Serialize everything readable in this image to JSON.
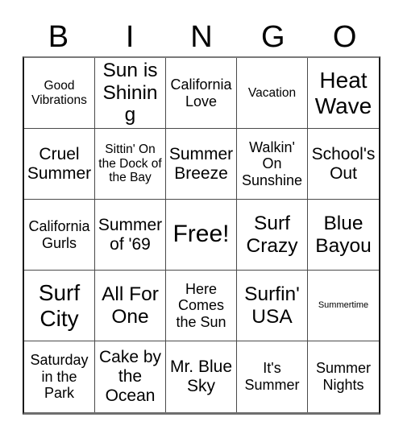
{
  "header": {
    "letters": [
      "B",
      "I",
      "N",
      "G",
      "O"
    ]
  },
  "grid": {
    "rows": [
      [
        {
          "text": "Good Vibrations",
          "size": "fs-sm"
        },
        {
          "text": "Sun is Shining",
          "size": "fs-xl"
        },
        {
          "text": "California Love",
          "size": "fs-md"
        },
        {
          "text": "Vacation",
          "size": "fs-sm"
        },
        {
          "text": "Heat Wave",
          "size": "fs-xxl"
        }
      ],
      [
        {
          "text": "Cruel Summer",
          "size": "fs-lg"
        },
        {
          "text": "Sittin' On the Dock of the Bay",
          "size": "fs-sm"
        },
        {
          "text": "Summer Breeze",
          "size": "fs-lg"
        },
        {
          "text": "Walkin' On Sunshine",
          "size": "fs-md"
        },
        {
          "text": "School's Out",
          "size": "fs-lg"
        }
      ],
      [
        {
          "text": "California Gurls",
          "size": "fs-md"
        },
        {
          "text": "Summer of '69",
          "size": "fs-lg"
        },
        {
          "text": "Free!",
          "size": "fs-free"
        },
        {
          "text": "Surf Crazy",
          "size": "fs-xl"
        },
        {
          "text": "Blue Bayou",
          "size": "fs-xl"
        }
      ],
      [
        {
          "text": "Surf City",
          "size": "fs-xxl"
        },
        {
          "text": "All For One",
          "size": "fs-xl"
        },
        {
          "text": "Here Comes the Sun",
          "size": "fs-md"
        },
        {
          "text": "Surfin' USA",
          "size": "fs-xl"
        },
        {
          "text": "Summertime",
          "size": "fs-xxs"
        }
      ],
      [
        {
          "text": "Saturday in the Park",
          "size": "fs-md"
        },
        {
          "text": "Cake by the Ocean",
          "size": "fs-lg"
        },
        {
          "text": "Mr. Blue Sky",
          "size": "fs-lg"
        },
        {
          "text": "It's Summer",
          "size": "fs-md"
        },
        {
          "text": "Summer Nights",
          "size": "fs-md"
        }
      ]
    ]
  },
  "colors": {
    "background": "#ffffff",
    "text": "#000000",
    "gridline": "#4a4a4a",
    "outer_border": "#1a1a1a"
  }
}
